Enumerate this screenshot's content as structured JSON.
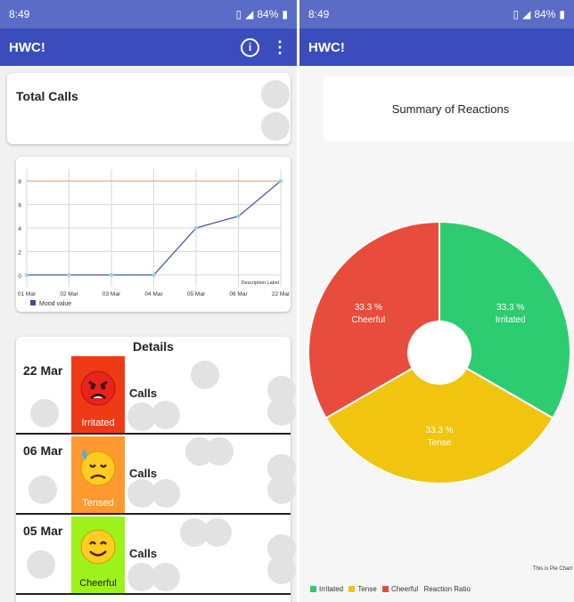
{
  "status": {
    "time": "8:49",
    "battery": "84%"
  },
  "app": {
    "title": "HWC!"
  },
  "left": {
    "total_calls_label": "Total Calls",
    "details_title": "Details"
  },
  "chart": {
    "description": "Description Label",
    "legend": "Mood value",
    "x_ticks": [
      "01 Mar",
      "02 Mar",
      "03 Mar",
      "04 Mar",
      "05 Mar",
      "06 Mar",
      "22 Mar"
    ],
    "y_ticks": [
      "0",
      "2",
      "4",
      "6",
      "8"
    ]
  },
  "chart_data": [
    {
      "type": "line",
      "categories": [
        "01 Mar",
        "02 Mar",
        "03 Mar",
        "04 Mar",
        "05 Mar",
        "06 Mar",
        "22 Mar"
      ],
      "series": [
        {
          "name": "Mood value",
          "values": [
            0,
            0,
            0,
            0,
            4,
            5,
            8
          ]
        }
      ],
      "ylim": [
        -1,
        9
      ],
      "grid": true,
      "limit_line": 8,
      "description": "Description Label",
      "legend_position": "bottom-left"
    },
    {
      "type": "pie",
      "title": "Summary of Reactions",
      "categories": [
        "Irritated",
        "Tense",
        "Cheerful"
      ],
      "values": [
        33.3,
        33.3,
        33.3
      ],
      "colors": [
        "#2ecc71",
        "#f1c40f",
        "#e74c3c"
      ],
      "legend_position": "bottom-left",
      "description": "Reaction Ratio"
    }
  ],
  "details": [
    {
      "date": "22 Mar",
      "mood": "Irritated",
      "calls": "Calls",
      "color": "#ee3b16"
    },
    {
      "date": "06 Mar",
      "mood": "Tensed",
      "calls": "Calls",
      "color": "#ff9930"
    },
    {
      "date": "05 Mar",
      "mood": "Cheerful",
      "calls": "Calls",
      "color": "#9cf21a"
    }
  ],
  "pie": {
    "title": "Summary of Reactions",
    "slices": [
      {
        "label": "Irritated",
        "pct": "33.3 %"
      },
      {
        "label": "Tense",
        "pct": "33.3 %"
      },
      {
        "label": "Cheerful",
        "pct": "33.3 %"
      }
    ],
    "corner_text": "This is Pie Chart",
    "legend": [
      "Irritated",
      "Tense",
      "Cheerful"
    ],
    "legend_desc": "Reaction Ratio"
  }
}
